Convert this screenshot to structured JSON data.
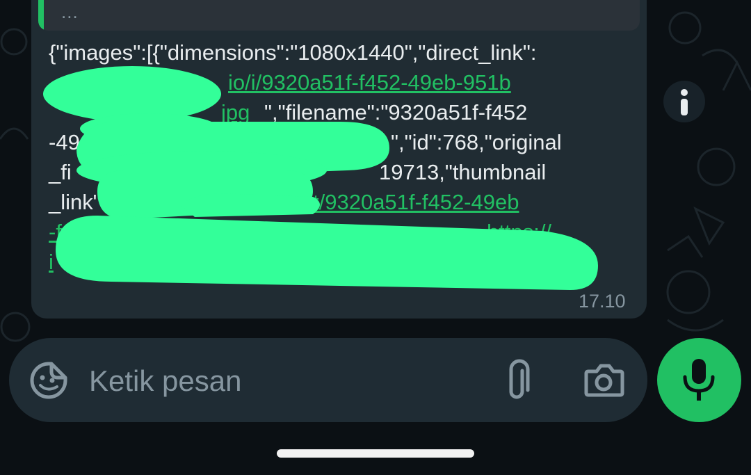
{
  "quoted_message": {
    "preview_text": "..."
  },
  "message": {
    "lines": [
      [
        {
          "text": "{\"images\":[{\"dimensions\":\"1080x1440\",\"direct_link\":",
          "link": false
        }
      ],
      [
        {
          "text": "io/i/9320a51f-f452-49eb-951b",
          "link": true
        }
      ],
      [
        {
          "text": "jpg",
          "link": true
        },
        {
          "text": "\",\"filename\":\"9320a51f-f452",
          "link": false
        }
      ],
      [
        {
          "text": "-49",
          "link": false
        },
        {
          "text": "\",\"id\":768,\"original",
          "link": false
        }
      ],
      [
        {
          "text": "_fi",
          "link": false
        },
        {
          "text": "19713,\"thumbnail",
          "link": false
        }
      ],
      [
        {
          "text": "_link\":\"",
          "link": false
        },
        {
          "text": "https:",
          "link": true
        },
        {
          "text": "t/9320a51f-f452-49eb",
          "link": true
        }
      ],
      [
        {
          "text": "-f",
          "link": true
        },
        {
          "text": "https://",
          "link": true
        }
      ],
      [
        {
          "text": "i",
          "link": true
        }
      ]
    ],
    "timestamp": "17.10",
    "redaction_color": "#33ff99"
  },
  "composer": {
    "placeholder": "Ketik pesan",
    "icons": [
      "sticker-icon",
      "attach-icon",
      "camera-icon",
      "mic-icon"
    ]
  },
  "colors": {
    "accent": "#21c063",
    "bubble": "#202c33",
    "background": "#0b1014"
  }
}
